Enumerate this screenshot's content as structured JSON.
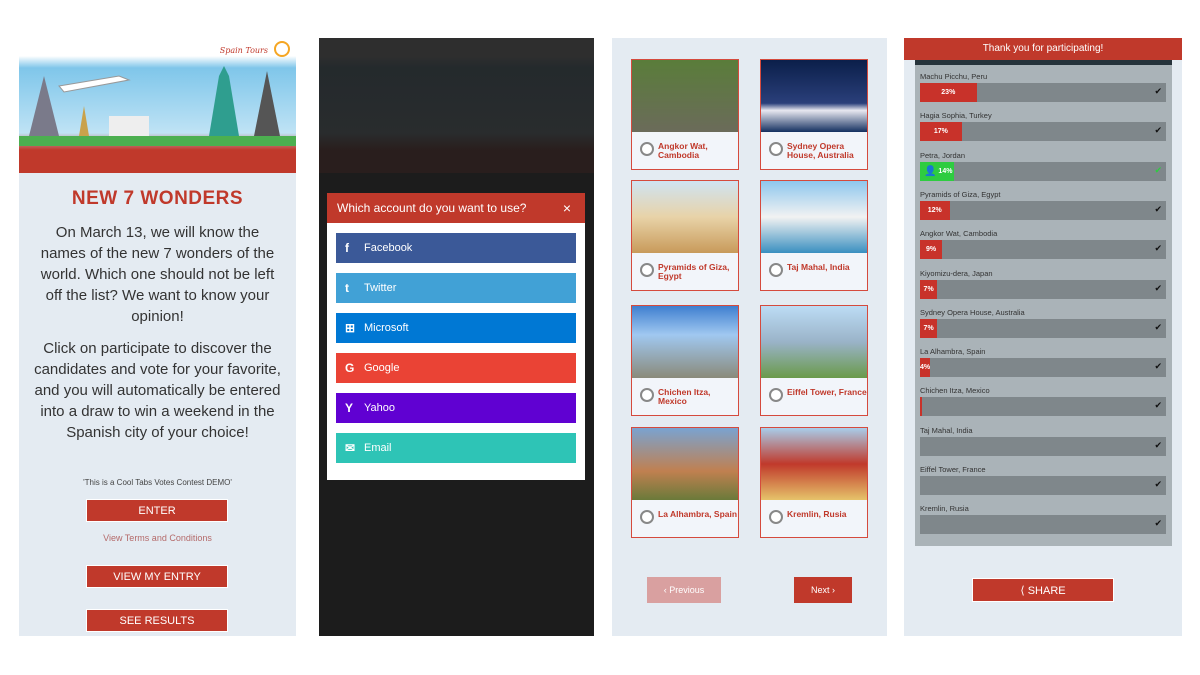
{
  "intro": {
    "logo": "Spain Tours",
    "title": "NEW 7 WONDERS",
    "paragraph1": "On March 13, we will know the names of the new 7 wonders of the world. Which one should not be left off the list? We want to know your opinion!",
    "paragraph2": "Click on participate to discover the candidates and vote for your favorite, and you will automatically be entered into a draw to win a weekend in the Spanish city of your choice!",
    "demo_note": "'This is a Cool Tabs Votes Contest DEMO'",
    "enter_label": "ENTER",
    "terms_link": "View Terms and Conditions",
    "view_entry_label": "VIEW MY ENTRY",
    "see_results_label": "SEE RESULTS"
  },
  "login_modal": {
    "title": "Which account do you want to use?",
    "close_icon": "×",
    "options": [
      {
        "label": "Facebook",
        "icon": "f",
        "color": "#3b5998"
      },
      {
        "label": "Twitter",
        "icon": "t",
        "color": "#41a1d6"
      },
      {
        "label": "Microsoft",
        "icon": "⊞",
        "color": "#0078d4"
      },
      {
        "label": "Google",
        "icon": "G",
        "color": "#ea4335"
      },
      {
        "label": "Yahoo",
        "icon": "Y",
        "color": "#6001d2"
      },
      {
        "label": "Email",
        "icon": "✉",
        "color": "#2ec4b6"
      }
    ]
  },
  "gallery": {
    "candidates": [
      {
        "label": "Angkor Wat, Cambodia"
      },
      {
        "label": "Sydney Opera House, Australia"
      },
      {
        "label": "Pyramids of Giza, Egypt"
      },
      {
        "label": "Taj Mahal, India"
      },
      {
        "label": "Chichen Itza, Mexico"
      },
      {
        "label": "Eiffel Tower, France"
      },
      {
        "label": "La Alhambra, Spain"
      },
      {
        "label": "Kremlin, Rusia"
      }
    ],
    "previous_label": "Previous",
    "next_label": "Next"
  },
  "results": {
    "header": "Thank you for participating!",
    "items": [
      {
        "name": "Machu Picchu, Peru",
        "percent": 23,
        "label": "23%"
      },
      {
        "name": "Hagia Sophia, Turkey",
        "percent": 17,
        "label": "17%"
      },
      {
        "name": "Petra, Jordan",
        "percent": 14,
        "label": "14%",
        "voted": true
      },
      {
        "name": "Pyramids of Giza, Egypt",
        "percent": 12,
        "label": "12%"
      },
      {
        "name": "Angkor Wat, Cambodia",
        "percent": 9,
        "label": "9%"
      },
      {
        "name": "Kiyomizu-dera, Japan",
        "percent": 7,
        "label": "7%"
      },
      {
        "name": "Sydney Opera House, Australia",
        "percent": 7,
        "label": "7%"
      },
      {
        "name": "La Alhambra, Spain",
        "percent": 4,
        "label": "4%"
      },
      {
        "name": "Chichen Itza, Mexico",
        "percent": 1,
        "label": ""
      },
      {
        "name": "Taj Mahal, India",
        "percent": 0,
        "label": ""
      },
      {
        "name": "Eiffel Tower, France",
        "percent": 0,
        "label": ""
      },
      {
        "name": "Kremlin, Rusia",
        "percent": 0,
        "label": ""
      }
    ],
    "share_label": "SHARE"
  },
  "colors": {
    "accent": "#c0392b",
    "voted": "#2ecc40"
  }
}
